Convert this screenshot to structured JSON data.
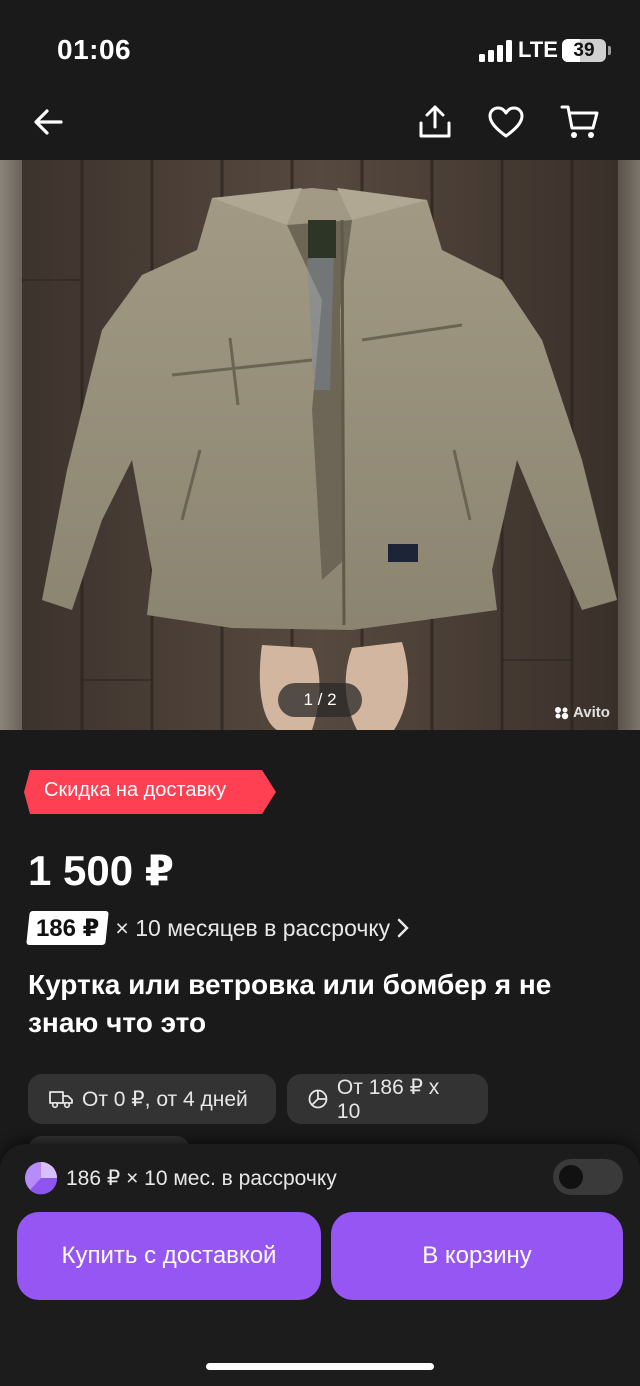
{
  "status_bar": {
    "time": "01:06",
    "network": "LTE",
    "battery": "39"
  },
  "nav": {
    "back_icon": "arrow-left-icon",
    "share_icon": "share-icon",
    "favorite_icon": "heart-icon",
    "cart_icon": "cart-icon"
  },
  "gallery": {
    "counter": "1 / 2",
    "watermark": "Avito"
  },
  "promo_badge": {
    "label": "Скидка на доставку",
    "color": "#ff4053"
  },
  "listing": {
    "price": "1 500 ₽",
    "installment_amount": "186 ₽",
    "installment_text": "× 10 месяцев в рассрочку",
    "title": "Куртка или ветровка или бомбер я не знаю что это"
  },
  "chips": [
    {
      "icon": "truck-icon",
      "label": "От 0 ₽, от 4 дней"
    },
    {
      "icon": "pie-chart-icon",
      "label": "От 186 ₽ х 10"
    }
  ],
  "bottom_sheet": {
    "installment_label": "186 ₽ × 10 мес. в рассрочку",
    "toggle_on": false,
    "buy_button": "Купить с доставкой",
    "cart_button": "В корзину",
    "accent": "#9656f3"
  }
}
